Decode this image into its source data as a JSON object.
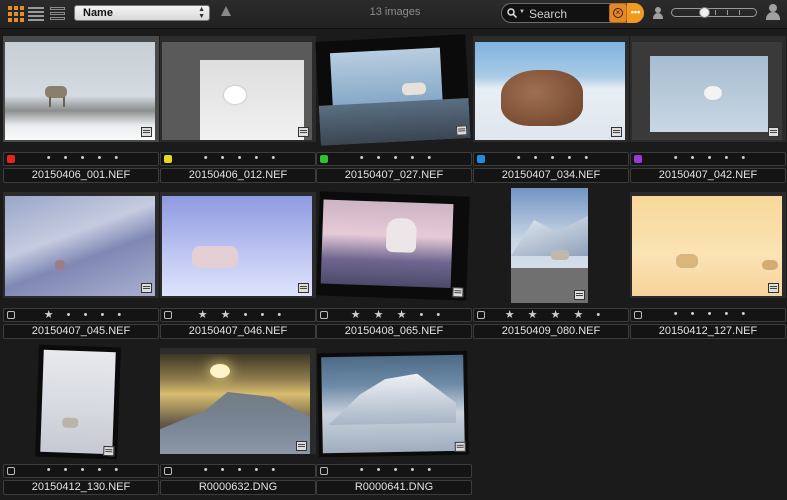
{
  "toolbar": {
    "view_modes": [
      {
        "name": "grid-view",
        "icon": "grid-view-icon",
        "active": true
      },
      {
        "name": "list-view",
        "icon": "list-view-icon",
        "active": false
      },
      {
        "name": "details-view",
        "icon": "details-view-icon",
        "active": false
      }
    ],
    "sort_by": "Name",
    "sort_direction_icon": "sort-ascending-icon",
    "image_count": "13 images",
    "search": {
      "placeholder": "Search"
    },
    "accent_color": "#e88b2a"
  },
  "thumbnails": [
    {
      "file": "20150406_001.NEF",
      "label_color": "#e0261e",
      "rating": "• • • • •",
      "selected": true
    },
    {
      "file": "20150406_012.NEF",
      "label_color": "#e8d81e",
      "rating": "• • • • •",
      "selected": false
    },
    {
      "file": "20150407_027.NEF",
      "label_color": "#2cc42c",
      "rating": "• • • • •",
      "selected": false
    },
    {
      "file": "20150407_034.NEF",
      "label_color": "#1e8ee0",
      "rating": "• • • • •",
      "selected": false
    },
    {
      "file": "20150407_042.NEF",
      "label_color": "#9a3ad8",
      "rating": "• • • • •",
      "selected": false
    },
    {
      "file": "20150407_045.NEF",
      "label_color": "",
      "rating": "★ • • • •",
      "selected": false
    },
    {
      "file": "20150407_046.NEF",
      "label_color": "",
      "rating": "★ ★ • • •",
      "selected": false
    },
    {
      "file": "20150408_065.NEF",
      "label_color": "",
      "rating": "★ ★ ★ • •",
      "selected": false
    },
    {
      "file": "20150409_080.NEF",
      "label_color": "",
      "rating": "★ ★ ★ ★ •",
      "selected": false
    },
    {
      "file": "20150412_127.NEF",
      "label_color": "",
      "rating": "• • • • •",
      "selected": false
    },
    {
      "file": "20150412_130.NEF",
      "label_color": "",
      "rating": "• • • • •",
      "selected": false
    },
    {
      "file": "R0000632.DNG",
      "label_color": "",
      "rating": "• • • • •",
      "selected": false
    },
    {
      "file": "R0000641.DNG",
      "label_color": "",
      "rating": "• • • • •",
      "selected": false
    }
  ]
}
